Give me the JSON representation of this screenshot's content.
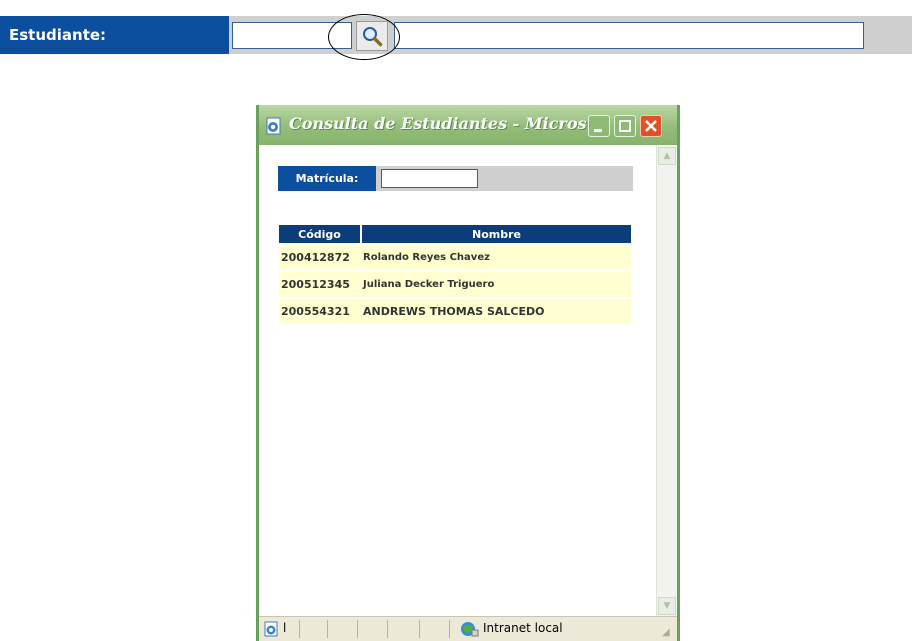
{
  "form": {
    "label": "Estudiante:",
    "search_button_icon": "magnifier-icon"
  },
  "popup": {
    "title": "Consulta de Estudiantes - Micros...",
    "window_icon": "ie-page-icon",
    "matricula_label": "Matrícula:",
    "matricula_value": "",
    "table": {
      "columns": [
        "Código",
        "Nombre"
      ],
      "rows": [
        {
          "code": "200412872",
          "name": "Rolando Reyes Chavez"
        },
        {
          "code": "200512345",
          "name": "Juliana Decker Triguero"
        },
        {
          "code": "200554321",
          "name": "ANDREWS THOMAS SALCEDO"
        }
      ]
    },
    "statusbar": {
      "left_text": "l",
      "zone": "Intranet local"
    }
  },
  "colors": {
    "label_bg": "#0b4f9e",
    "header_bg": "#0b3d7a",
    "row_bg": "#ffffcf",
    "titlebar": "#93bd78",
    "close_button": "#e0512a"
  }
}
